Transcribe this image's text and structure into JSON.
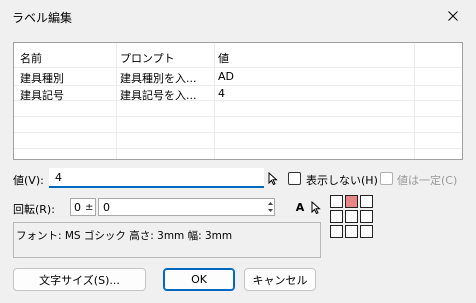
{
  "window": {
    "title": "ラベル編集"
  },
  "icons": {
    "close": "close-icon",
    "pick": "cursor-arrow-icon",
    "letter": "text-a-icon",
    "spin": "spin-arrows-icon"
  },
  "list": {
    "headers": [
      "名前",
      "プロンプト",
      "値"
    ],
    "rows": [
      [
        "建具種別",
        "建具種別を入...",
        "AD"
      ],
      [
        "建具記号",
        "建具記号を入...",
        "4"
      ]
    ]
  },
  "value_field": {
    "label": "値(V):",
    "value": "4"
  },
  "hide_checkbox": {
    "label": "表示しない(H)",
    "checked": false
  },
  "constant_checkbox": {
    "label": "値は一定(C)",
    "checked": false,
    "enabled": false
  },
  "rotation": {
    "label": "回転(R):",
    "base": "0",
    "plus_minus": "±",
    "value": "0"
  },
  "text_button": {
    "label": "A"
  },
  "font_info": "フォント: MS ゴシック 高さ: 3mm 幅: 3mm",
  "buttons": {
    "text_size": "文字サイズ(S)...",
    "ok": "OK",
    "cancel": "キャンセル"
  },
  "anchor_grid": {
    "selected_index": 1,
    "selected_color": "#e88585"
  }
}
